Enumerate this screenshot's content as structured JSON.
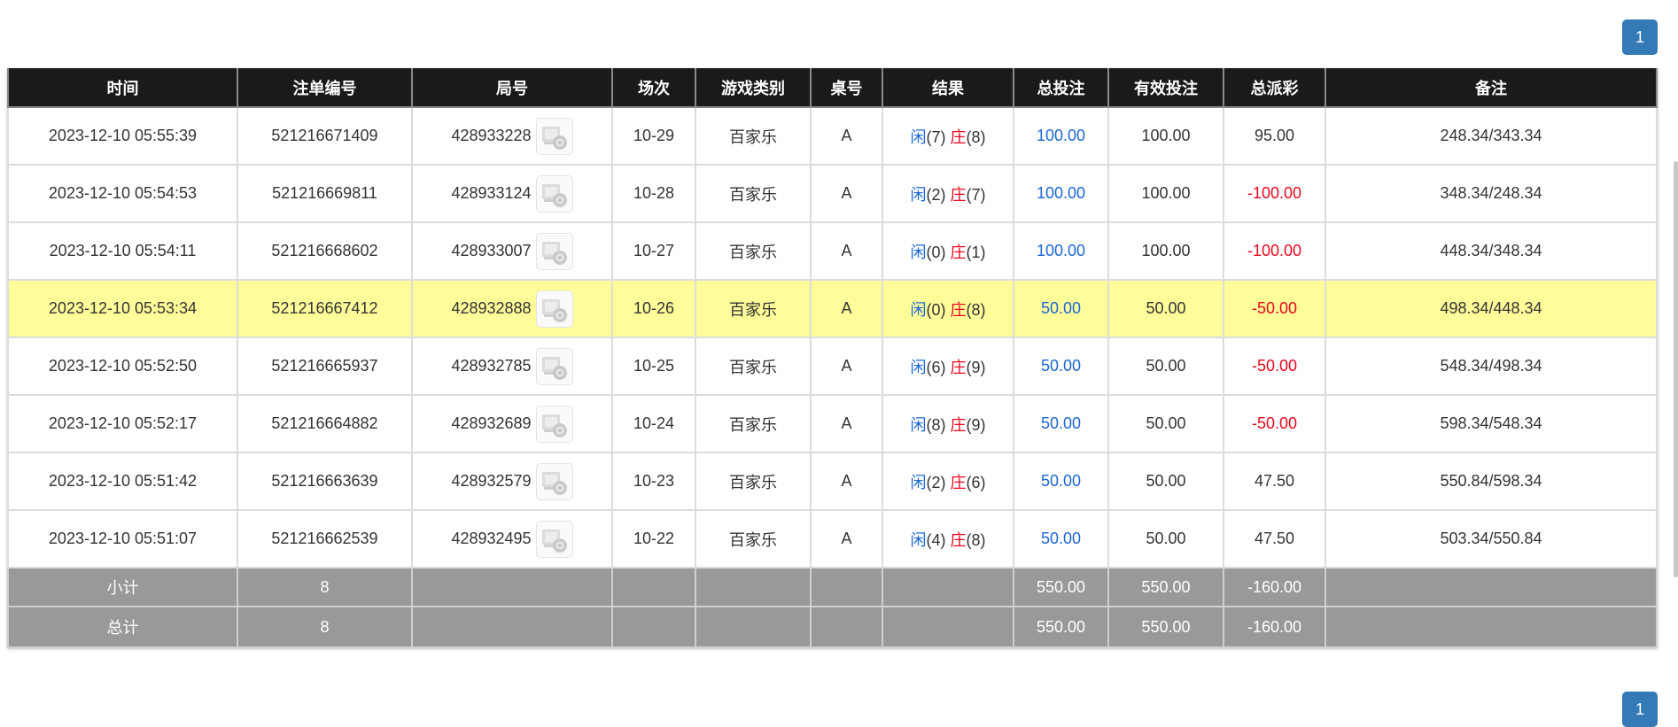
{
  "pagination": {
    "current_page": "1"
  },
  "table": {
    "headers": [
      "时间",
      "注单编号",
      "局号",
      "场次",
      "游戏类别",
      "桌号",
      "结果",
      "总投注",
      "有效投注",
      "总派彩",
      "备注"
    ],
    "player_label": "闲",
    "banker_label": "庄",
    "highlight_color": "#fefd99",
    "rows": [
      {
        "time": "2023-12-10 05:55:39",
        "bet_id": "521216671409",
        "round_id": "428933228",
        "session": "10-29",
        "game": "百家乐",
        "table": "A",
        "player_score": "(7)",
        "banker_score": "(8)",
        "total_bet": "100.00",
        "valid_bet": "100.00",
        "payout": "95.00",
        "payout_negative": false,
        "note": "248.34/343.34",
        "highlighted": false
      },
      {
        "time": "2023-12-10 05:54:53",
        "bet_id": "521216669811",
        "round_id": "428933124",
        "session": "10-28",
        "game": "百家乐",
        "table": "A",
        "player_score": "(2)",
        "banker_score": "(7)",
        "total_bet": "100.00",
        "valid_bet": "100.00",
        "payout": "-100.00",
        "payout_negative": true,
        "note": "348.34/248.34",
        "highlighted": false
      },
      {
        "time": "2023-12-10 05:54:11",
        "bet_id": "521216668602",
        "round_id": "428933007",
        "session": "10-27",
        "game": "百家乐",
        "table": "A",
        "player_score": "(0)",
        "banker_score": "(1)",
        "total_bet": "100.00",
        "valid_bet": "100.00",
        "payout": "-100.00",
        "payout_negative": true,
        "note": "448.34/348.34",
        "highlighted": false
      },
      {
        "time": "2023-12-10 05:53:34",
        "bet_id": "521216667412",
        "round_id": "428932888",
        "session": "10-26",
        "game": "百家乐",
        "table": "A",
        "player_score": "(0)",
        "banker_score": "(8)",
        "total_bet": "50.00",
        "valid_bet": "50.00",
        "payout": "-50.00",
        "payout_negative": true,
        "note": "498.34/448.34",
        "highlighted": true
      },
      {
        "time": "2023-12-10 05:52:50",
        "bet_id": "521216665937",
        "round_id": "428932785",
        "session": "10-25",
        "game": "百家乐",
        "table": "A",
        "player_score": "(6)",
        "banker_score": "(9)",
        "total_bet": "50.00",
        "valid_bet": "50.00",
        "payout": "-50.00",
        "payout_negative": true,
        "note": "548.34/498.34",
        "highlighted": false
      },
      {
        "time": "2023-12-10 05:52:17",
        "bet_id": "521216664882",
        "round_id": "428932689",
        "session": "10-24",
        "game": "百家乐",
        "table": "A",
        "player_score": "(8)",
        "banker_score": "(9)",
        "total_bet": "50.00",
        "valid_bet": "50.00",
        "payout": "-50.00",
        "payout_negative": true,
        "note": "598.34/548.34",
        "highlighted": false
      },
      {
        "time": "2023-12-10 05:51:42",
        "bet_id": "521216663639",
        "round_id": "428932579",
        "session": "10-23",
        "game": "百家乐",
        "table": "A",
        "player_score": "(2)",
        "banker_score": "(6)",
        "total_bet": "50.00",
        "valid_bet": "50.00",
        "payout": "47.50",
        "payout_negative": false,
        "note": "550.84/598.34",
        "highlighted": false
      },
      {
        "time": "2023-12-10 05:51:07",
        "bet_id": "521216662539",
        "round_id": "428932495",
        "session": "10-22",
        "game": "百家乐",
        "table": "A",
        "player_score": "(4)",
        "banker_score": "(8)",
        "total_bet": "50.00",
        "valid_bet": "50.00",
        "payout": "47.50",
        "payout_negative": false,
        "note": "503.34/550.84",
        "highlighted": false
      }
    ],
    "subtotal": {
      "label": "小计",
      "count": "8",
      "total_bet": "550.00",
      "valid_bet": "550.00",
      "payout": "-160.00"
    },
    "total": {
      "label": "总计",
      "count": "8",
      "total_bet": "550.00",
      "valid_bet": "550.00",
      "payout": "-160.00"
    }
  }
}
